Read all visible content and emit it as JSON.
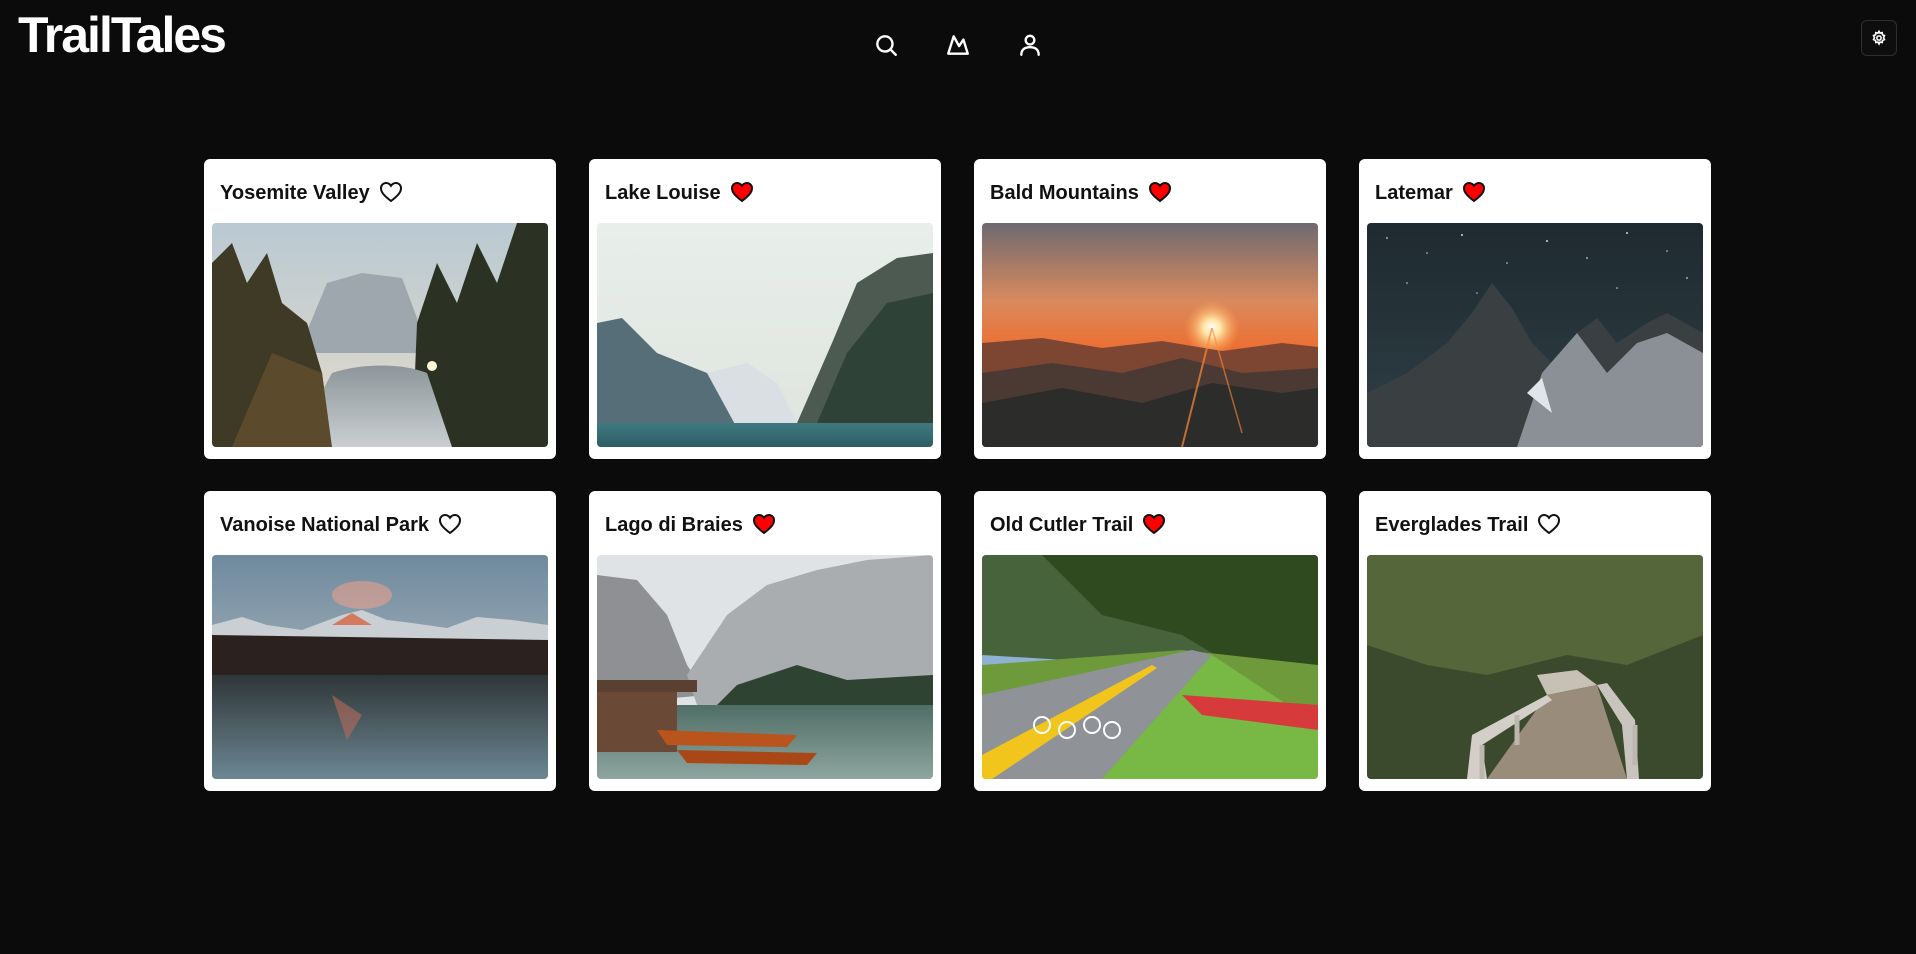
{
  "app": {
    "logo": "TrailTales"
  },
  "nav": {
    "items": [
      {
        "icon": "search-icon"
      },
      {
        "icon": "mountain-icon"
      },
      {
        "icon": "user-icon"
      }
    ],
    "settings_icon": "gear-icon"
  },
  "colors": {
    "background": "#0b0b0b",
    "heart_filled": "#ff0000",
    "card": "#ffffff"
  },
  "trails": [
    {
      "name": "Yosemite Valley",
      "favorited": false
    },
    {
      "name": "Lake Louise",
      "favorited": true
    },
    {
      "name": "Bald Mountains",
      "favorited": true
    },
    {
      "name": "Latemar",
      "favorited": true
    },
    {
      "name": "Vanoise National Park",
      "favorited": false
    },
    {
      "name": "Lago di Braies",
      "favorited": true
    },
    {
      "name": "Old Cutler Trail",
      "favorited": true
    },
    {
      "name": "Everglades Trail",
      "favorited": false
    }
  ]
}
